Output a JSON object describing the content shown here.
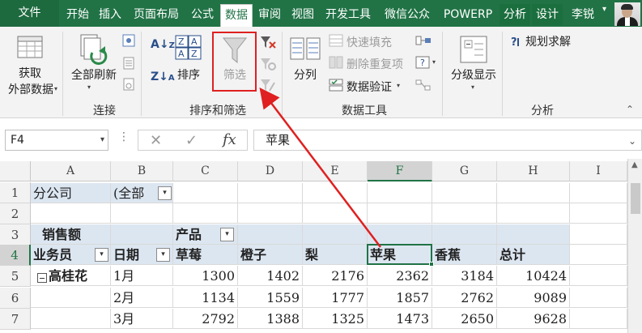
{
  "tabs": {
    "file": "文件",
    "items": [
      "开始",
      "插入",
      "页面布局",
      "公式",
      "数据",
      "审阅",
      "视图",
      "开发工具",
      "微信公众",
      "POWERP",
      "分析",
      "设计"
    ],
    "active": "数据",
    "user": "李锐"
  },
  "ribbon": {
    "groups": {
      "connections": "连接",
      "sort_filter": "排序和筛选",
      "data_tools": "数据工具",
      "analysis": "分析"
    },
    "get_external_line1": "获取",
    "get_external_line2": "外部数据",
    "refresh_all": "全部刷新",
    "sort": "排序",
    "filter": "筛选",
    "text_to_columns": "分列",
    "flash_fill": "快速填充",
    "remove_duplicates": "删除重复项",
    "data_validation": "数据验证",
    "outline": "分级显示",
    "solver": "规划求解"
  },
  "formula_bar": {
    "name_box": "F4",
    "fx": "fx",
    "content": "苹果"
  },
  "grid": {
    "columns": [
      "A",
      "B",
      "C",
      "D",
      "E",
      "F",
      "G",
      "H",
      "I"
    ],
    "rows": [
      "1",
      "2",
      "3",
      "4",
      "5",
      "6",
      "7"
    ],
    "r1": {
      "a": "分公司",
      "b": "(全部"
    },
    "r3": {
      "a": "销售额",
      "c": "产品"
    },
    "r4": {
      "a": "业务员",
      "b": "日期",
      "c": "草莓",
      "d": "橙子",
      "e": "梨",
      "f": "苹果",
      "g": "香蕉",
      "h": "总计"
    },
    "r5": {
      "a": "高桂花",
      "b": "1月",
      "c": "1300",
      "d": "1402",
      "e": "2176",
      "f": "2362",
      "g": "3184",
      "h": "10424"
    },
    "r6": {
      "b": "2月",
      "c": "1134",
      "d": "1559",
      "e": "1777",
      "f": "1857",
      "g": "2762",
      "h": "9089"
    },
    "r7": {
      "b": "3月",
      "c": "2792",
      "d": "1388",
      "e": "1325",
      "f": "1473",
      "g": "2650",
      "h": "9628"
    }
  },
  "colors": {
    "excel_green": "#217346",
    "highlight_red": "#e02020",
    "pivot_blue": "#dce6f1"
  }
}
